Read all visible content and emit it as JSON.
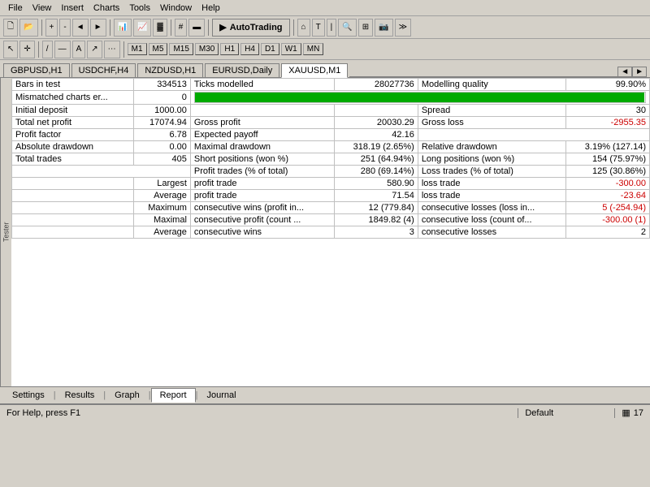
{
  "menubar": {
    "items": [
      "File",
      "View",
      "Insert",
      "Charts",
      "Tools",
      "Window",
      "Help"
    ]
  },
  "toolbar": {
    "autotrading_label": "AutoTrading",
    "periods": [
      "M1",
      "M5",
      "M15",
      "M30",
      "H1",
      "H4",
      "D1",
      "W1",
      "MN"
    ]
  },
  "tabs": [
    {
      "label": "GBPUSD,H1"
    },
    {
      "label": "USDCHF,H4"
    },
    {
      "label": "NZDUSD,H1"
    },
    {
      "label": "EURUSD,Daily"
    },
    {
      "label": "XAUUSD,M1",
      "active": true
    }
  ],
  "report": {
    "rows": [
      {
        "col1_label": "Bars in test",
        "col1_value": "334513",
        "col2_label": "Ticks modelled",
        "col2_value": "28027736",
        "col3_label": "Modelling quality",
        "col3_value": "99.90%"
      },
      {
        "col1_label": "Mismatched charts er...",
        "col1_value": "0",
        "col2_label": "",
        "col2_value": "PROGRESS_BAR",
        "col3_label": "",
        "col3_value": ""
      },
      {
        "col1_label": "Initial deposit",
        "col1_value": "1000.00",
        "col2_label": "",
        "col2_value": "",
        "col3_label": "Spread",
        "col3_value": "30"
      },
      {
        "col1_label": "Total net profit",
        "col1_value": "17074.94",
        "col2_label": "Gross profit",
        "col2_value": "20030.29",
        "col3_label": "Gross loss",
        "col3_value": "-2955.35"
      },
      {
        "col1_label": "Profit factor",
        "col1_value": "6.78",
        "col2_label": "Expected payoff",
        "col2_value": "42.16",
        "col3_label": "",
        "col3_value": ""
      },
      {
        "col1_label": "Absolute drawdown",
        "col1_value": "0.00",
        "col2_label": "Maximal drawdown",
        "col2_value": "318.19 (2.65%)",
        "col3_label": "Relative drawdown",
        "col3_value": "3.19% (127.14)"
      },
      {
        "col1_label": "Total trades",
        "col1_value": "405",
        "col2_label": "Short positions (won %)",
        "col2_value": "251 (64.94%)",
        "col3_label": "Long positions (won %)",
        "col3_value": "154 (75.97%)"
      },
      {
        "col1_label": "",
        "col1_value": "",
        "col2_label": "Profit trades (% of total)",
        "col2_value": "280 (69.14%)",
        "col3_label": "Loss trades (% of total)",
        "col3_value": "125 (30.86%)"
      },
      {
        "col1_label": "",
        "col1_sublabel": "Largest",
        "col2_label": "profit trade",
        "col2_value": "580.90",
        "col3_label": "loss trade",
        "col3_value": "-300.00"
      },
      {
        "col1_label": "",
        "col1_sublabel": "Average",
        "col2_label": "profit trade",
        "col2_value": "71.54",
        "col3_label": "loss trade",
        "col3_value": "-23.64"
      },
      {
        "col1_label": "",
        "col1_sublabel": "Maximum",
        "col2_label": "consecutive wins (profit in...",
        "col2_value": "12 (779.84)",
        "col3_label": "consecutive losses (loss in...",
        "col3_value": "5 (-254.94)"
      },
      {
        "col1_label": "",
        "col1_sublabel": "Maximal",
        "col2_label": "consecutive profit (count ...",
        "col2_value": "1849.82 (4)",
        "col3_label": "consecutive loss (count of...",
        "col3_value": "-300.00 (1)"
      },
      {
        "col1_label": "",
        "col1_sublabel": "Average",
        "col2_label": "consecutive wins",
        "col2_value": "3",
        "col3_label": "consecutive losses",
        "col3_value": "2"
      }
    ]
  },
  "bottom_tabs": [
    {
      "label": "Settings"
    },
    {
      "label": "Results"
    },
    {
      "label": "Graph"
    },
    {
      "label": "Report",
      "active": true
    },
    {
      "label": "Journal"
    }
  ],
  "statusbar": {
    "help_text": "For Help, press F1",
    "default_text": "Default",
    "right_text": "17"
  }
}
